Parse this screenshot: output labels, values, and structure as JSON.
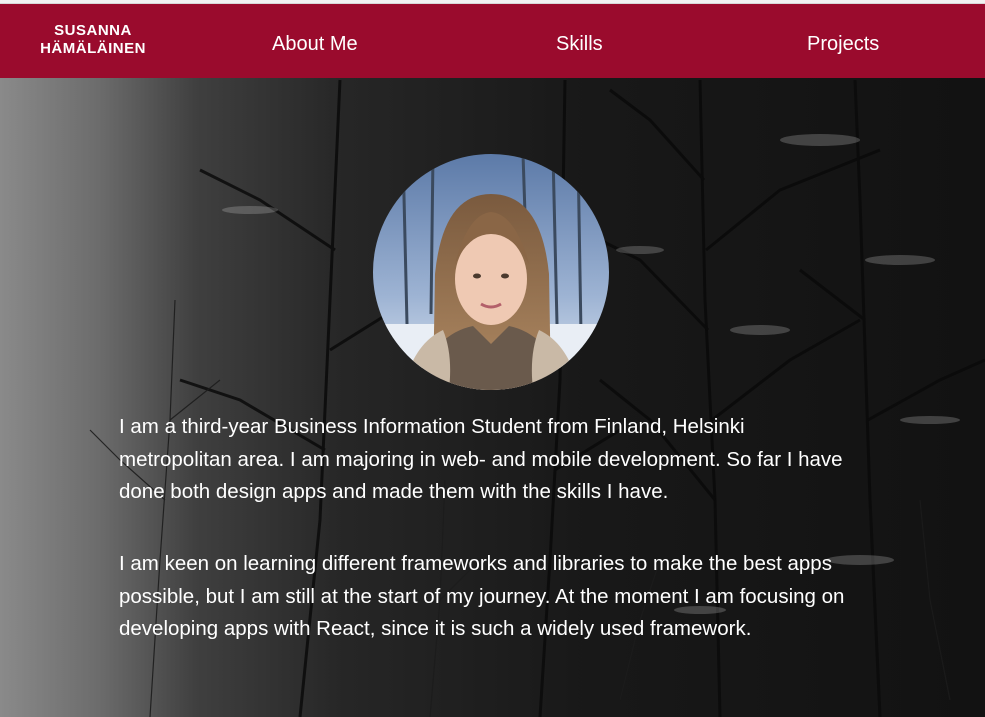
{
  "header": {
    "brand_line1": "SUSANNA",
    "brand_line2": "HÄMÄLÄINEN",
    "nav": [
      {
        "label": "About Me"
      },
      {
        "label": "Skills"
      },
      {
        "label": "Projects"
      }
    ]
  },
  "main": {
    "bio_paragraphs": [
      "I am a third-year Business Information Student from Finland, Helsinki metropolitan area. I am majoring in web- and mobile development. So far I have done both design apps and made them with the skills I have.",
      "I am keen on learning different frameworks and libraries to make the best apps possible, but I am still at the start of my journey. At the moment I am focusing on developing apps with React, since it is such a widely used framework."
    ]
  },
  "colors": {
    "header_bg": "#9a0b2d",
    "text": "#ffffff"
  }
}
